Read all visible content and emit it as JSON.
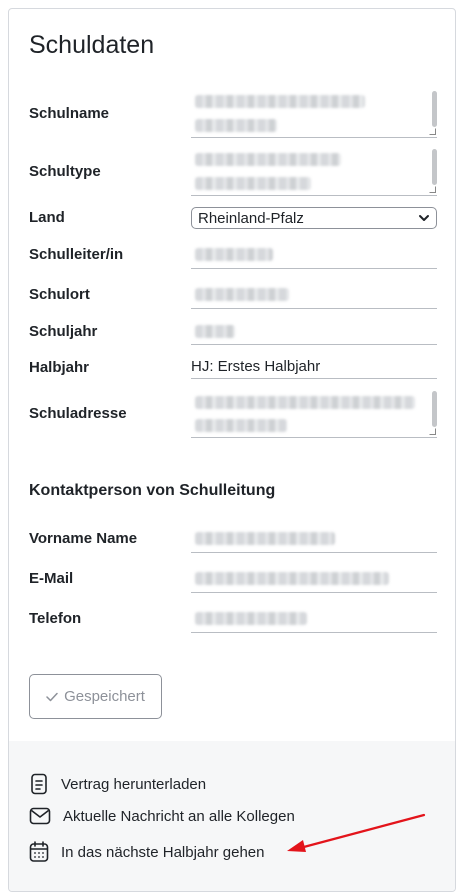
{
  "page": {
    "title": "Schuldaten"
  },
  "form": {
    "fields": [
      {
        "label": "Schulname"
      },
      {
        "label": "Schultype"
      },
      {
        "label": "Land"
      },
      {
        "label": "Schulleiter/in"
      },
      {
        "label": "Schulort"
      },
      {
        "label": "Schuljahr"
      },
      {
        "label": "Halbjahr"
      },
      {
        "label": "Schuladresse"
      }
    ],
    "land_value": "Rheinland-Pfalz",
    "halbjahr_value": "HJ: Erstes Halbjahr"
  },
  "contact": {
    "section_title": "Kontaktperson von Schulleitung",
    "fields": [
      {
        "label": "Vorname Name"
      },
      {
        "label": "E-Mail"
      },
      {
        "label": "Telefon"
      }
    ]
  },
  "save_button": {
    "label": "Gespeichert",
    "icon": "check-icon"
  },
  "actions": [
    {
      "label": "Vertrag herunterladen",
      "icon": "document-icon"
    },
    {
      "label": "Aktuelle Nachricht an alle Kollegen",
      "icon": "envelope-icon"
    },
    {
      "label": "In das nächste Halbjahr gehen",
      "icon": "calendar-icon"
    }
  ],
  "colors": {
    "annotation_arrow": "#e3141b",
    "footer_bg": "#f6f7f8",
    "border": "#d6d9de"
  }
}
